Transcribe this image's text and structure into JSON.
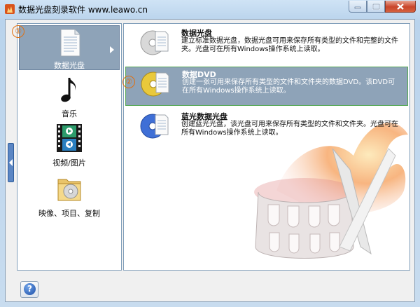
{
  "window": {
    "title": "数据光盘刻录软件 www.leawo.cn",
    "controls": [
      "minimize",
      "maximize",
      "close"
    ]
  },
  "categories": [
    {
      "label": "数据光盘",
      "icon": "document-icon",
      "selected": true
    },
    {
      "label": "音乐",
      "icon": "music-note-icon",
      "selected": false
    },
    {
      "label": "视频/图片",
      "icon": "film-strip-icon",
      "selected": false
    },
    {
      "label": "映像、项目、复制",
      "icon": "folder-disc-icon",
      "selected": false
    }
  ],
  "options": [
    {
      "title": "数据光盘",
      "desc": "建立标准数据光盘，数据光盘可用来保存所有类型的文件和完整的文件夹。光盘可在所有Windows操作系统上读取。",
      "icon": "cd-disc-icon",
      "selected": false
    },
    {
      "title": "数据DVD",
      "desc": "创建一张可用来保存所有类型的文件和文件夹的数据DVD。该DVD可在所有Windows操作系统上读取。",
      "icon": "dvd-disc-icon",
      "selected": true
    },
    {
      "title": "蓝光数据光盘",
      "desc": "创建蓝光光盘，该光盘可用来保存所有类型的文件和文件夹。光盘可在所有Windows操作系统上读取。",
      "icon": "bluray-disc-icon",
      "selected": false
    }
  ],
  "markers": {
    "one": "①",
    "two": "②"
  },
  "help": {
    "label": "?"
  },
  "colors": {
    "selection": "#8ea3b8",
    "marker": "#e07010",
    "flame": "#f07a2a"
  }
}
